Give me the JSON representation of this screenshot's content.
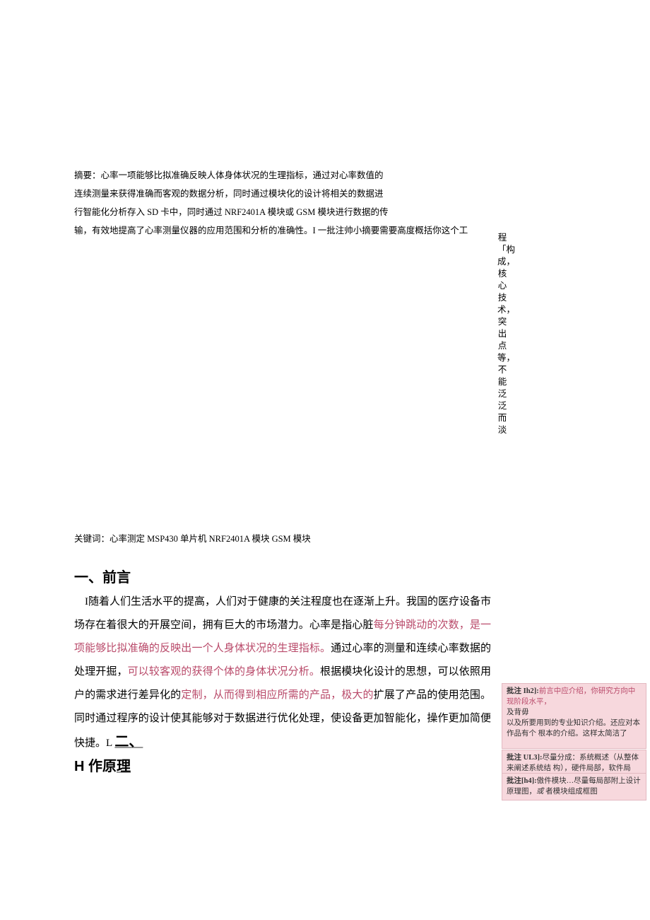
{
  "abstract": {
    "label": "摘要：",
    "line1": "心率一项能够比拟准确反映人体身体状况的生理指标，通过对心率数值的",
    "line2": "连续测量来获得准确而客观的数据分析，同时通过模块化的设计将相关的数据进",
    "line3": "行智能化分析存入 SD 卡中，同时通过 NRF2401A 模块或 GSM 模块进行数据的传",
    "line4": "输，有效地提高了心率测量仪器的应用范围和分析的准确性。I 一批注帅小摘要需要高度概括你这个工"
  },
  "vertical_note": "程「构成，核心技术，突出点等，不能泛泛而淡",
  "keywords": {
    "label": "关键词：",
    "text": "心率测定 MSP430 单片机 NRF2401A 模块 GSM 模块"
  },
  "headings": {
    "preface": "一、前言",
    "section2_prefix": "L ",
    "section2_cn": "二、",
    "section2_title": "H 作原",
    "section2_title_u": "理"
  },
  "body": {
    "p1a": "I随着人们生活水平的提高，人们对于健康的关注程度也在逐渐上升。我国的医疗设备市场存在着很大的开展空间，拥有巨大的市场潜力。心率是指心脏",
    "p1b": "每分钟跳动的次数，是一项能够比拟准确的反映出一个人身体状况的生理指标。",
    "p1c": "通过心率的测量和连续心率数据的处理开掘，",
    "p1d": "可以较客观的获得个体的身体状况分析。",
    "p1e": "根据模块化设计的思想，可以依照用户的需求进行差异化的",
    "p1f": "定制，从而得到相应所需的产品，极大的",
    "p1g": "扩展了产品的使用范围。同时通过程序的设计使其能够对于数据进行优化处理，使设备更加智能化，操作更加简便快捷。"
  },
  "comments": {
    "c1": {
      "tag": "批注 Ih2]:",
      "l1": "前言中应介绍，你研究方向中现阶段水平，",
      "l2": "及背毋",
      "l3": "以及所要用到的专业知识介绍。还应对本作品有个 根本的介绍。这样太简洁了"
    },
    "c2": {
      "tag": "批注 UL3]:",
      "text": "尽量分成：系统概述（从整体来阐述系统结 构），硬件局部，软件局部。"
    },
    "c3": {
      "tag": "批注[h4]:",
      "t1": "傲件模块…尽量每局部附上设计原理图，",
      "ital": "或",
      "t2": " 者模块组成框图"
    }
  }
}
